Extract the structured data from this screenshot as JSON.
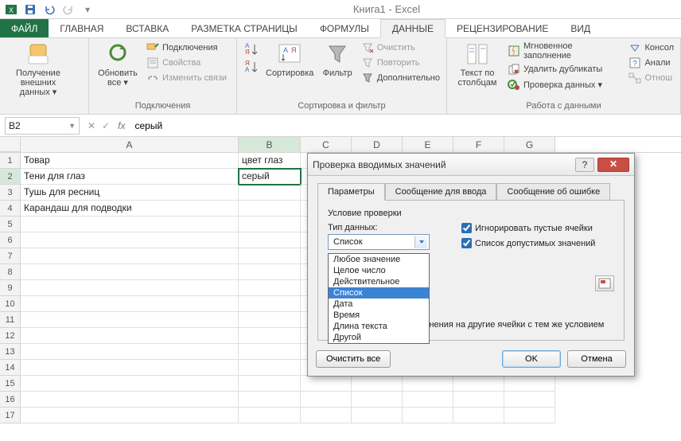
{
  "app": {
    "title": "Книга1 - Excel"
  },
  "ribbon_tabs": {
    "file": "ФАЙЛ",
    "home": "ГЛАВНАЯ",
    "insert": "ВСТАВКА",
    "page_layout": "РАЗМЕТКА СТРАНИЦЫ",
    "formulas": "ФОРМУЛЫ",
    "data": "ДАННЫЕ",
    "review": "РЕЦЕНЗИРОВАНИЕ",
    "view": "ВИД"
  },
  "ribbon": {
    "get_external": "Получение\nвнешних данных ▾",
    "refresh_all": "Обновить\nвсе ▾",
    "connections": "Подключения",
    "properties": "Свойства",
    "edit_links": "Изменить связи",
    "group_connections": "Подключения",
    "sort": "Сортировка",
    "filter": "Фильтр",
    "clear": "Очистить",
    "reapply": "Повторить",
    "advanced": "Дополнительно",
    "group_sort_filter": "Сортировка и фильтр",
    "text_to_columns": "Текст по\nстолбцам",
    "flash_fill": "Мгновенное заполнение",
    "remove_dup": "Удалить дубликаты",
    "data_validation": "Проверка данных ▾",
    "consolidate": "Консол",
    "whatif": "Анали",
    "relations": "Отнош",
    "group_data_tools": "Работа с данными"
  },
  "formula_bar": {
    "name_box": "B2",
    "fx": "fx",
    "value": "серый"
  },
  "columns": [
    "A",
    "B",
    "C",
    "D",
    "E",
    "F",
    "G"
  ],
  "rows": [
    1,
    2,
    3,
    4,
    5,
    6,
    7,
    8,
    9,
    10,
    11,
    12,
    13,
    14,
    15,
    16,
    17
  ],
  "cells": {
    "a1": "Товар",
    "b1": "цвет глаз",
    "a2": "Тени для глаз",
    "b2": "серый",
    "a3": "Тушь для ресниц",
    "a4": "Карандаш для подводки"
  },
  "dialog": {
    "title": "Проверка вводимых значений",
    "tab_params": "Параметры",
    "tab_input_msg": "Сообщение для ввода",
    "tab_error_msg": "Сообщение об ошибке",
    "cond_title": "Условие проверки",
    "type_label": "Тип данных:",
    "type_value": "Список",
    "type_options": [
      "Любое значение",
      "Целое число",
      "Действительное",
      "Список",
      "Дата",
      "Время",
      "Длина текста",
      "Другой"
    ],
    "ignore_blank": "Игнорировать пустые ячейки",
    "in_cell_dropdown": "Список допустимых значений",
    "apply_all": "Распространить изменения на другие ячейки с тем же условием",
    "clear_all": "Очистить все",
    "ok": "OK",
    "cancel": "Отмена",
    "help": "?",
    "close": "✕"
  }
}
